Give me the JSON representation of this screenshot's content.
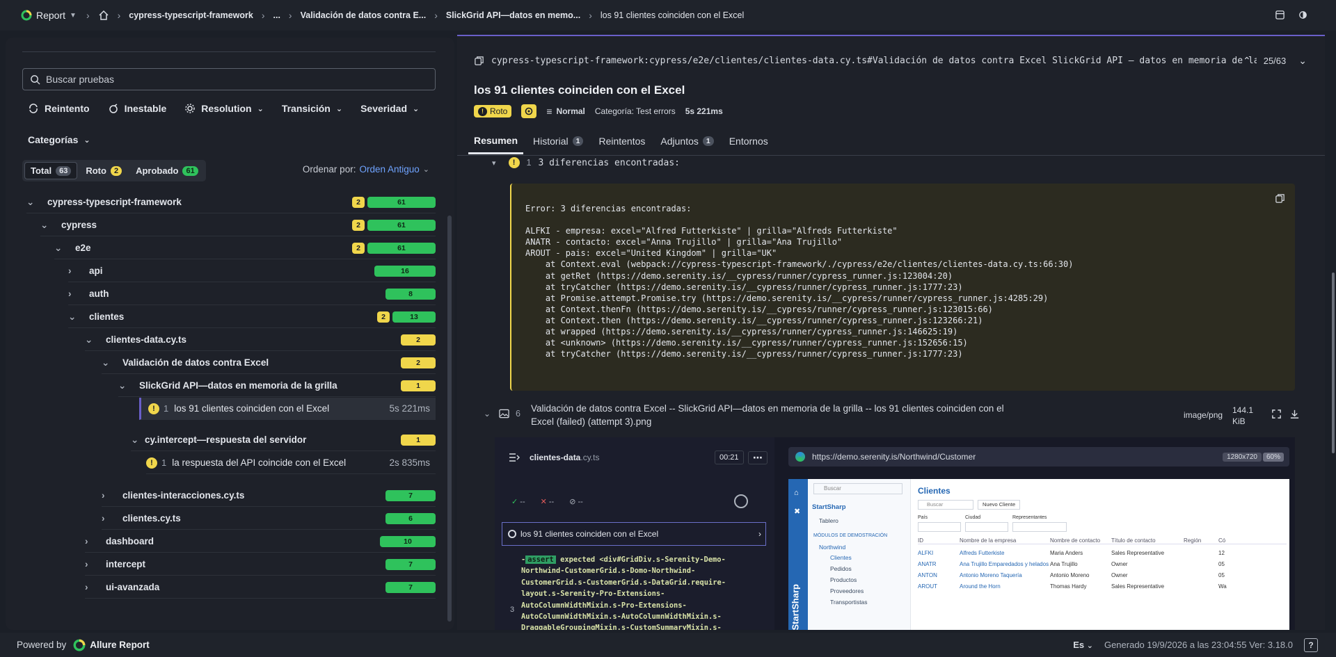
{
  "topbar": {
    "brand": "Report",
    "crumbs": [
      "cypress-typescript-framework",
      "...",
      "Validación de datos contra E...",
      "SlickGrid API—datos en memo...",
      "los 91 clientes coinciden con el Excel"
    ]
  },
  "sidebar": {
    "search_placeholder": "Buscar pruebas",
    "filters": [
      "Reintento",
      "Inestable",
      "Resolution",
      "Transición",
      "Severidad"
    ],
    "categories_label": "Categorías",
    "tabs": [
      {
        "label": "Total",
        "count": "63"
      },
      {
        "label": "Roto",
        "count": "2"
      },
      {
        "label": "Aprobado",
        "count": "61"
      }
    ],
    "sort_label": "Ordenar por:",
    "sort_value": "Orden Antiguo",
    "tree": [
      {
        "label": "cypress-typescript-framework",
        "broken": "2",
        "passed": "61"
      },
      {
        "label": "cypress",
        "broken": "2",
        "passed": "61"
      },
      {
        "label": "e2e",
        "broken": "2",
        "passed": "61"
      },
      {
        "label": "api",
        "passed": "16"
      },
      {
        "label": "auth",
        "passed": "8"
      },
      {
        "label": "clientes",
        "broken": "2",
        "passed": "13"
      },
      {
        "label": "clientes-data.cy.ts",
        "broken": "2"
      },
      {
        "label": "Validación de datos contra Excel",
        "broken": "2"
      },
      {
        "label": "SlickGrid API—datos en memoria de la grilla",
        "broken": "1"
      },
      {
        "label": "los 91 clientes coinciden con el Excel",
        "num": "1",
        "duration": "5s 221ms"
      },
      {
        "label": "cy.intercept—respuesta del servidor",
        "broken": "1"
      },
      {
        "label": "la respuesta del API coincide con el Excel",
        "num": "1",
        "duration": "2s 835ms"
      },
      {
        "label": "clientes-interacciones.cy.ts",
        "passed": "7"
      },
      {
        "label": "clientes.cy.ts",
        "passed": "6"
      },
      {
        "label": "dashboard",
        "passed": "10"
      },
      {
        "label": "intercept",
        "passed": "7"
      },
      {
        "label": "ui-avanzada",
        "passed": "7"
      }
    ]
  },
  "detail": {
    "path": "cypress-typescript-framework:cypress/e2e/clientes/clientes-data.cy.ts#Validación de datos contra Excel SlickGrid API — datos en memoria de la grilla",
    "position": "25/63",
    "title": "los 91 clientes coinciden con el Excel",
    "status": "Roto",
    "severity": "Normal",
    "category": "Categoría: Test errors",
    "duration": "5s 221ms",
    "tabs": [
      {
        "label": "Resumen"
      },
      {
        "label": "Historial",
        "count": "1"
      },
      {
        "label": "Reintentos"
      },
      {
        "label": "Adjuntos",
        "count": "1"
      },
      {
        "label": "Entornos"
      }
    ],
    "error_num": "1",
    "error_head": "3 diferencias encontradas:",
    "error_text": "Error: 3 diferencias encontradas:\n\nALFKI - empresa: excel=\"Alfred Futterkiste\" | grilla=\"Alfreds Futterkiste\"\nANATR - contacto: excel=\"Anna Trujillo\" | grilla=\"Ana Trujillo\"\nAROUT - pais: excel=\"United Kingdom\" | grilla=\"UK\"\n    at Context.eval (webpack://cypress-typescript-framework/./cypress/e2e/clientes/clientes-data.cy.ts:66:30)\n    at getRet (https://demo.serenity.is/__cypress/runner/cypress_runner.js:123004:20)\n    at tryCatcher (https://demo.serenity.is/__cypress/runner/cypress_runner.js:1777:23)\n    at Promise.attempt.Promise.try (https://demo.serenity.is/__cypress/runner/cypress_runner.js:4285:29)\n    at Context.thenFn (https://demo.serenity.is/__cypress/runner/cypress_runner.js:123015:66)\n    at Context.then (https://demo.serenity.is/__cypress/runner/cypress_runner.js:123266:21)\n    at wrapped (https://demo.serenity.is/__cypress/runner/cypress_runner.js:146625:19)\n    at <unknown> (https://demo.serenity.is/__cypress/runner/cypress_runner.js:152656:15)\n    at tryCatcher (https://demo.serenity.is/__cypress/runner/cypress_runner.js:1777:23)",
    "attachment": {
      "num": "6",
      "name": "Validación de datos contra Excel -- SlickGrid API—datos en memoria de la grilla -- los 91 clientes coinciden con el Excel (failed) (attempt 3).png",
      "type": "image/png",
      "size": "144.1 KiB"
    }
  },
  "screenshot": {
    "spec": "clientes-data",
    "spec_ext": ".cy.ts",
    "time": "00:21",
    "stats": [
      "--",
      "--",
      "--"
    ],
    "test": "los 91 clientes coinciden con el Excel",
    "assert_kw": "assert",
    "assert_text": "expected <div#GridDiv.s-Serenity-Demo-Northwind-CustomerGrid.s-Domo-Northwind-CustomerGrid.s-CustomerGrid.s-DataGrid.require-layout.s-Serenity-Pro-Extensions-AutoColumnWidthMixin.s-Pro-Extensions-AutoColumnWidthMixin.s-AutoColumnWidthMixin.s-DraggableGroupingMixin.s-CustomSummaryMixin.s-",
    "cmd_num": "3",
    "url": "https://demo.serenity.is/Northwind/Customer",
    "resolution": "1280x720",
    "zoom": "60%",
    "app": {
      "search": "Buscar",
      "brand": "StartSharp",
      "dashboard": "Tablero",
      "section": "MÓDULOS DE DEMOSTRACIÓN",
      "group": "Northwind",
      "items": [
        "Clientes",
        "Pedidos",
        "Productos",
        "Proveedores",
        "Transportistas"
      ],
      "page_title": "Clientes",
      "grid_search": "Buscar",
      "new_button": "Nuevo Cliente",
      "filter_labels": [
        "País",
        "Ciudad",
        "Representantes"
      ],
      "vertical_brand": "StartSharp",
      "columns": [
        "ID",
        "Nombre de la empresa",
        "Nombre de contacto",
        "Título de contacto",
        "Región",
        "Có"
      ],
      "rows": [
        [
          "ALFKI",
          "Alfreds Futterkiste",
          "Maria Anders",
          "Sales Representative",
          "",
          "12"
        ],
        [
          "ANATR",
          "Ana Trujillo Emparedados y helados",
          "Ana Trujillo",
          "Owner",
          "",
          "05"
        ],
        [
          "ANTON",
          "Antonio Moreno Taquería",
          "Antonio Moreno",
          "Owner",
          "",
          "05"
        ],
        [
          "AROUT",
          "Around the Horn",
          "Thomas Hardy",
          "Sales Representative",
          "",
          "Wa"
        ]
      ]
    }
  },
  "footer": {
    "powered": "Powered by",
    "brand": "Allure Report",
    "lang": "Es",
    "generated": "Generado 19/9/2026 a las 23:04:55 Ver: 3.18.0",
    "help": "?"
  },
  "colors": {
    "broken": "#f0d64b",
    "passed": "#2fc25c",
    "accent": "#6a5fc9"
  }
}
